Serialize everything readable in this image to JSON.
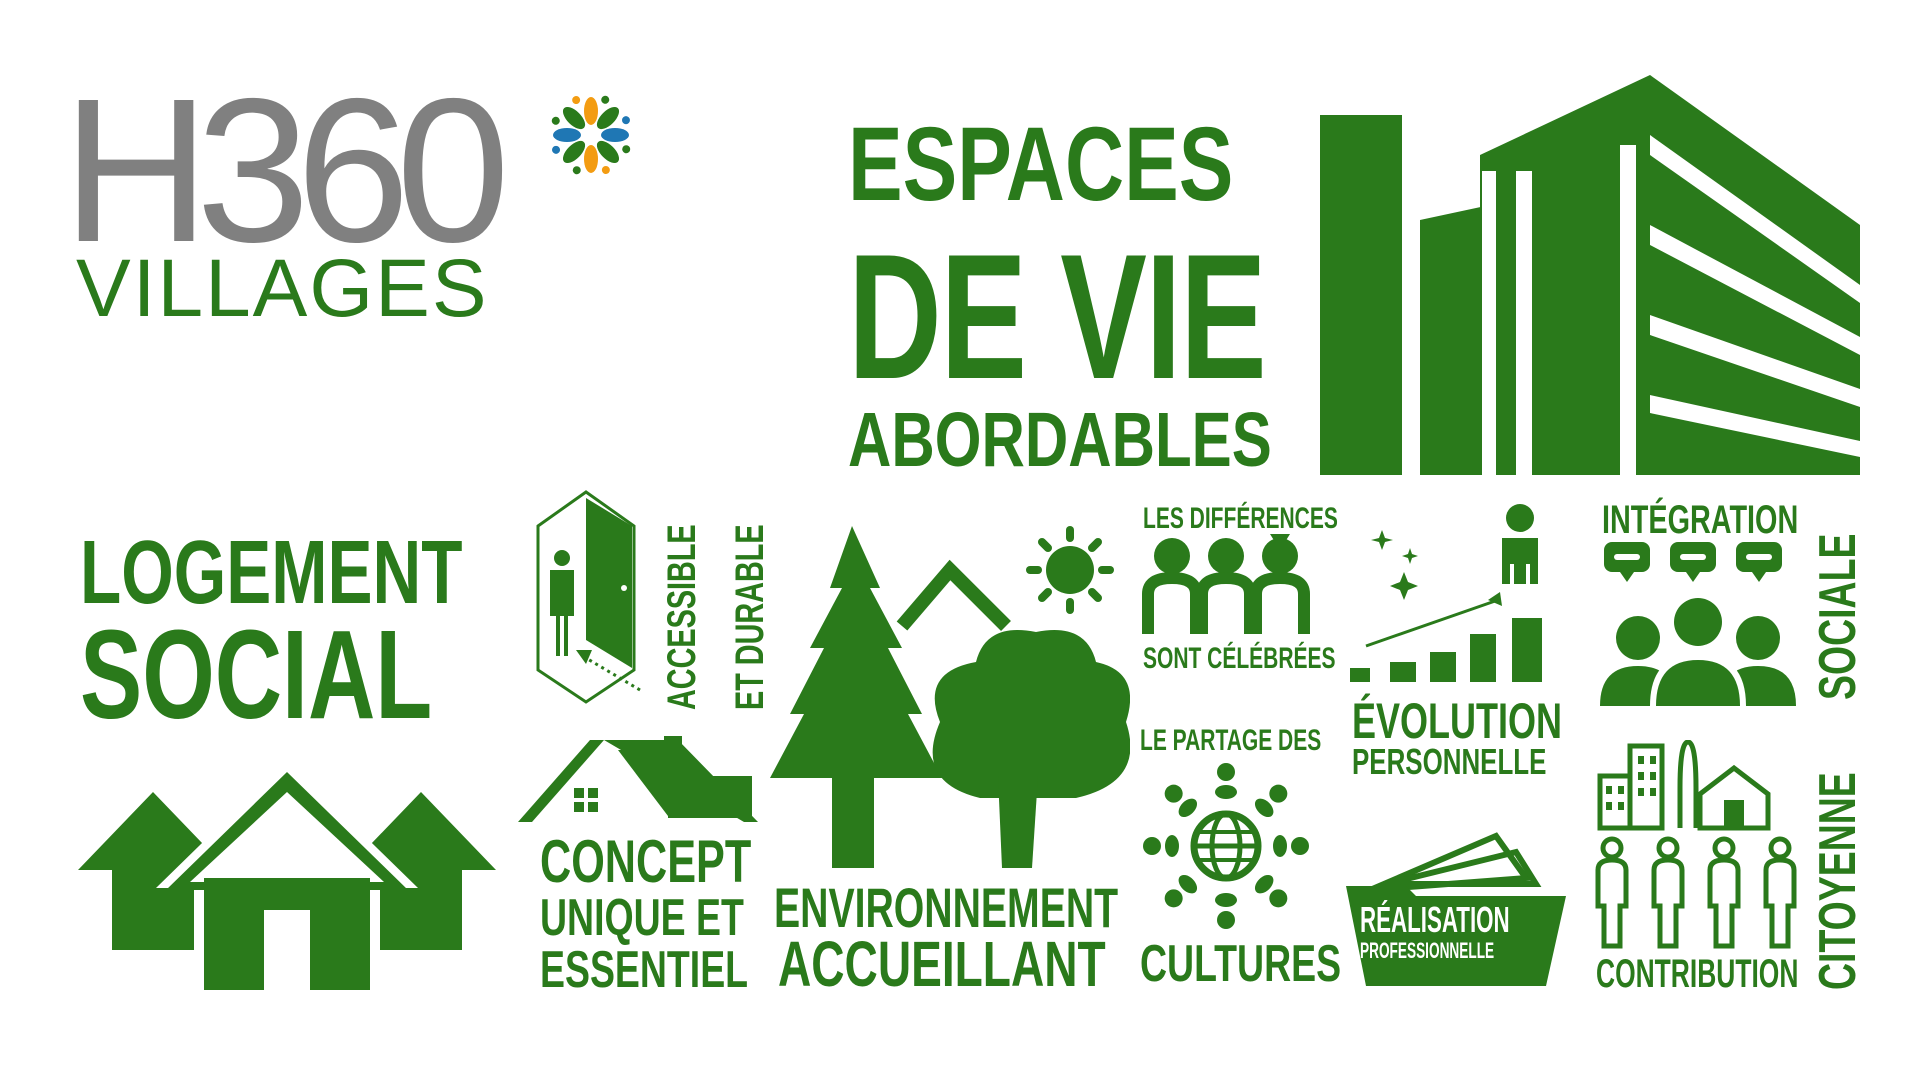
{
  "brand": {
    "name": "H360",
    "sub": "VILLAGES",
    "colors": {
      "grey": "#808080",
      "green": "#2a7a1b"
    }
  },
  "headline": {
    "line1": "ESPACES",
    "line2": "DE VIE",
    "line3": "ABORDABLES"
  },
  "logement": {
    "line1": "LOGEMENT",
    "line2": "SOCIAL"
  },
  "accessible": {
    "line1": "ACCESSIBLE",
    "line2": "ET DURABLE"
  },
  "concept": {
    "line1": "CONCEPT",
    "line2": "UNIQUE ET",
    "line3": "ESSENTIEL"
  },
  "environnement": {
    "line1": "ENVIRONNEMENT",
    "line2": "ACCUEILLANT"
  },
  "differences": {
    "line1": "LES DIFFÉRENCES",
    "line2": "SONT CÉLÉBRÉES"
  },
  "partage": {
    "line1": "LE PARTAGE DES",
    "line2": "CULTURES"
  },
  "evolution": {
    "line1": "ÉVOLUTION",
    "line2": "PERSONNELLE"
  },
  "realisation": {
    "line1": "RÉALISATION",
    "line2": "PROFESSIONNELLE"
  },
  "integration": {
    "line1": "INTÉGRATION",
    "line2": "SOCIALE"
  },
  "contribution": {
    "line1": "CONTRIBUTION",
    "line2": "CITOYENNE"
  },
  "icons": [
    "flower-logo-icon",
    "building-icon",
    "houses-icon",
    "door-person-icon",
    "house-icon",
    "trees-sun-icon",
    "people-group-icon",
    "globe-people-icon",
    "growth-chart-icon",
    "folder-icon",
    "speech-people-icon",
    "city-people-icon"
  ]
}
